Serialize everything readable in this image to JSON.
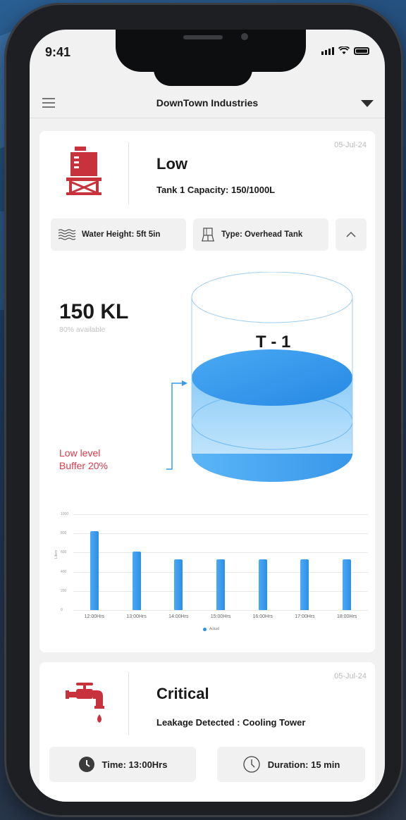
{
  "status_bar": {
    "time": "9:41"
  },
  "header": {
    "title": "DownTown Industries"
  },
  "card1": {
    "date": "05-Jul-24",
    "status": "Low",
    "subtitle": "Tank 1 Capacity: 150/1000L",
    "chips": {
      "water_height": "Water Height: 5ft 5in",
      "type": "Type: Overhead Tank"
    },
    "volume": "150 KL",
    "available": "80% available",
    "buffer_line1": "Low level",
    "buffer_line2": "Buffer 20%",
    "tank_label": "T - 1"
  },
  "card2": {
    "date": "05-Jul-24",
    "status": "Critical",
    "subtitle": "Leakage Detected : Cooling Tower",
    "time_label": "Time: 13:00Hrs",
    "duration_label": "Duration: 15 min"
  },
  "colors": {
    "accent_red": "#c8323c",
    "alert_red": "#dd3b4b",
    "water_blue": "#2e8fe6"
  },
  "chart_data": {
    "type": "bar",
    "categories": [
      "12:00Hrs",
      "13:00Hrs",
      "14:00Hrs",
      "15:00Hrs",
      "16:00Hrs",
      "17:00Hrs",
      "18:00Hrs"
    ],
    "series": [
      {
        "name": "Actual",
        "values": [
          820,
          610,
          530,
          530,
          530,
          530,
          530
        ]
      }
    ],
    "yticks": [
      "1000",
      "800",
      "600",
      "400",
      "200",
      "0"
    ],
    "ylabel": "Liters",
    "ylim": [
      0,
      1000
    ],
    "legend": "bottom"
  }
}
